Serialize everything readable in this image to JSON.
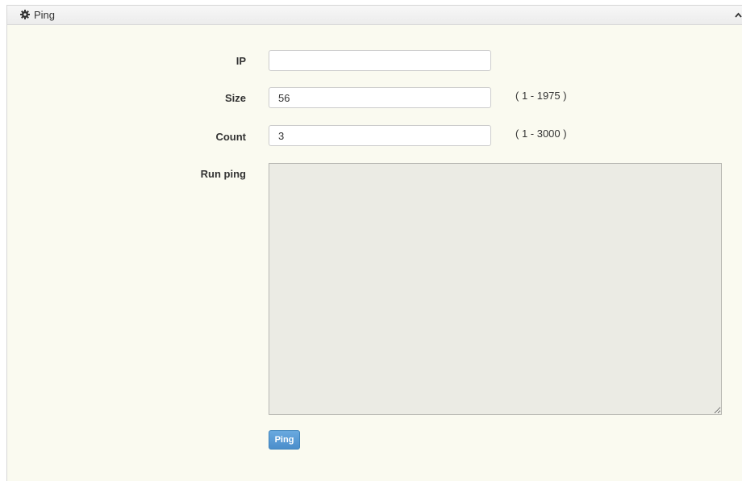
{
  "panel": {
    "title": "Ping",
    "icon": "gear-icon",
    "collapse_icon": "chevron-up-icon"
  },
  "form": {
    "ip": {
      "label": "IP",
      "value": ""
    },
    "size": {
      "label": "Size",
      "value": "56",
      "range": "( 1 - 1975 )"
    },
    "count": {
      "label": "Count",
      "value": "3",
      "range": "( 1 - 3000 )"
    },
    "run_ping": {
      "label": "Run ping",
      "output": ""
    }
  },
  "actions": {
    "ping_label": "Ping"
  },
  "colors": {
    "panel_background": "#fafaf0",
    "header_background": "#ececec",
    "output_background": "#ebebe4",
    "button_primary": "#4b8ecb"
  }
}
